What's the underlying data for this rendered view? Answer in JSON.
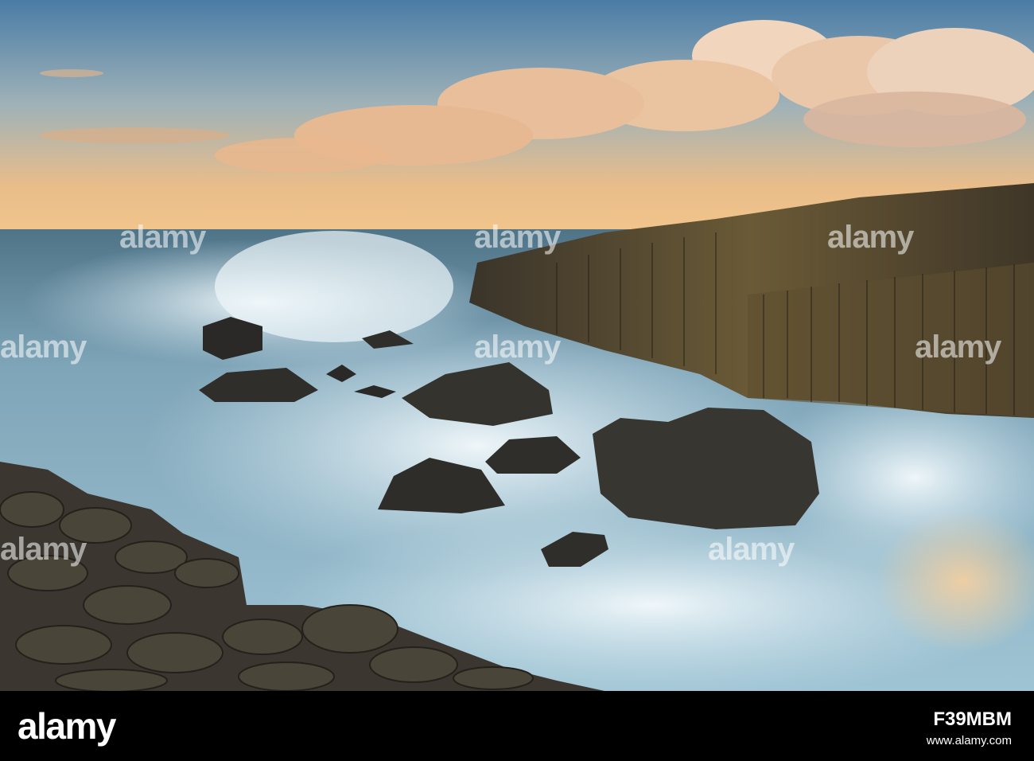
{
  "photo": {
    "subject": "Waves crashing over basalt columns and boulders at sunset",
    "colors": {
      "sky_top": "#4d7fa6",
      "sky_horizon": "#f0c28a",
      "cloud": "#f3d0b0",
      "sea": "#5e8fa6",
      "foam": "#e6f1f6",
      "rock_dark": "#2c2a27",
      "rock_lit": "#7b6a3d"
    }
  },
  "watermark": {
    "text": "alamy"
  },
  "footer": {
    "logo": "alamy",
    "image_id": "F39MBM",
    "url": "www.alamy.com"
  }
}
